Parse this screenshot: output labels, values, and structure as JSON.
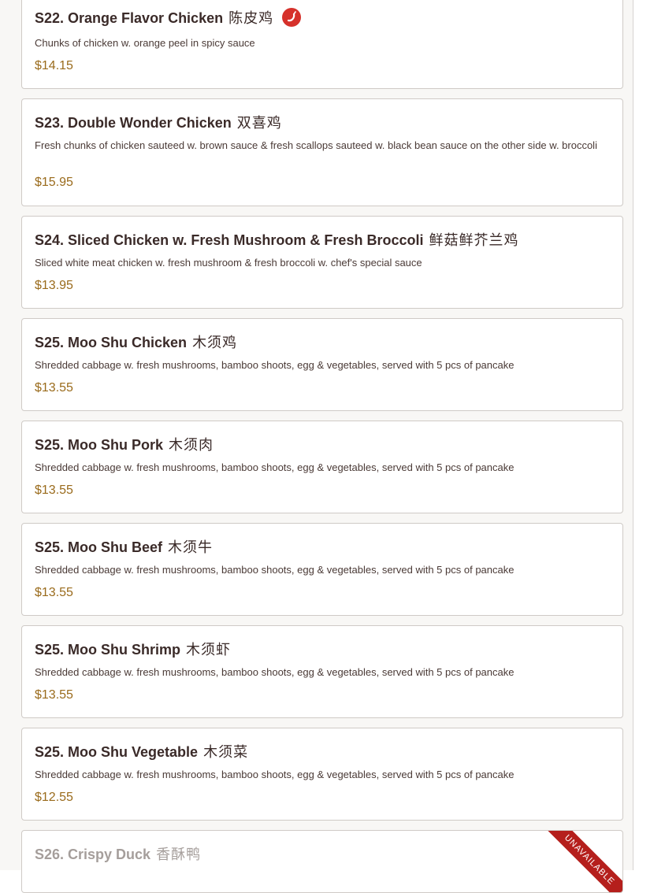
{
  "items": [
    {
      "title": "S22. Orange Flavor Chicken",
      "title_cn": "陈皮鸡",
      "spicy": true,
      "description": "Chunks of chicken w. orange peel in spicy sauce",
      "price": "$14.15"
    },
    {
      "title": "S23. Double Wonder Chicken",
      "title_cn": "双喜鸡",
      "description": "Fresh chunks of chicken sauteed w. brown sauce & fresh scallops sauteed w. black bean sauce on the other side w. broccoli",
      "price": "$15.95"
    },
    {
      "title": "S24. Sliced Chicken w. Fresh Mushroom & Fresh Broccoli",
      "title_cn": "鲜菇鲜芥兰鸡",
      "description": "Sliced white meat chicken w. fresh mushroom & fresh broccoli w. chef's special sauce",
      "price": "$13.95"
    },
    {
      "title": "S25. Moo Shu Chicken",
      "title_cn": "木须鸡",
      "description": "Shredded cabbage w. fresh mushrooms, bamboo shoots, egg & vegetables, served with 5 pcs of pancake",
      "price": "$13.55"
    },
    {
      "title": "S25. Moo Shu Pork",
      "title_cn": "木须肉",
      "description": "Shredded cabbage w. fresh mushrooms, bamboo shoots, egg & vegetables, served with 5 pcs of pancake",
      "price": "$13.55"
    },
    {
      "title": "S25. Moo Shu Beef",
      "title_cn": "木须牛",
      "description": "Shredded cabbage w. fresh mushrooms, bamboo shoots, egg & vegetables, served with 5 pcs of pancake",
      "price": "$13.55"
    },
    {
      "title": "S25. Moo Shu Shrimp",
      "title_cn": "木须虾",
      "description": "Shredded cabbage w. fresh mushrooms, bamboo shoots, egg & vegetables, served with 5 pcs of pancake",
      "price": "$13.55"
    },
    {
      "title": "S25. Moo Shu Vegetable",
      "title_cn": "木须菜",
      "description": "Shredded cabbage w. fresh mushrooms, bamboo shoots, egg & vegetables, served with 5 pcs of pancake",
      "price": "$12.55"
    },
    {
      "title": "S26. Crispy Duck",
      "title_cn": "香酥鸭",
      "unavailable_label": "UNAVAILABLE",
      "description": "",
      "price": ""
    }
  ],
  "colors": {
    "spicy_icon": "#d6312b",
    "price": "#9a6b1c",
    "ribbon": "#b51f1c"
  }
}
